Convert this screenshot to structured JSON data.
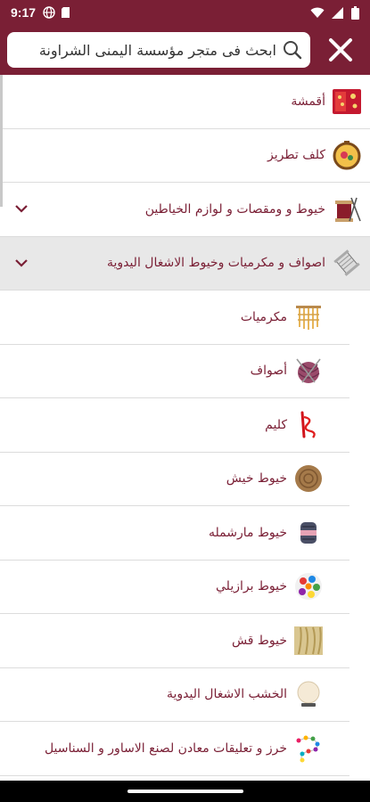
{
  "status": {
    "time": "9:17"
  },
  "search": {
    "placeholder": "ابحث فى متجر مؤسسة اليمنى الشراونة",
    "value": ""
  },
  "categories": [
    {
      "label": "أقمشة",
      "icon": "fabric-icon",
      "has_children": false
    },
    {
      "label": "كلف تطريز",
      "icon": "embroidery-hoop-icon",
      "has_children": false
    },
    {
      "label": "خيوط و ومقصات و لوازم الخياطين",
      "icon": "sewing-supplies-icon",
      "has_children": true,
      "expanded": false
    },
    {
      "label": "اصواف و مكرميات وخيوط الاشغال اليدوية",
      "icon": "thread-spool-icon",
      "has_children": true,
      "expanded": true
    }
  ],
  "subcategories": [
    {
      "label": "مكرميات",
      "icon": "macrame-icon"
    },
    {
      "label": "أصواف",
      "icon": "yarn-ball-icon"
    },
    {
      "label": "كليم",
      "icon": "kilim-needle-icon"
    },
    {
      "label": "خيوط خيش",
      "icon": "jute-twine-icon"
    },
    {
      "label": "خيوط مارشمله",
      "icon": "marshmallow-yarn-icon"
    },
    {
      "label": "خيوط برازيلي",
      "icon": "brazilian-thread-icon"
    },
    {
      "label": "خيوط قش",
      "icon": "straw-thread-icon"
    },
    {
      "label": "الخشب الاشغال اليدوية",
      "icon": "wood-craft-icon"
    },
    {
      "label": "خرز و تعليقات معادن لصنع الاساور و السناسيل",
      "icon": "beads-icon"
    }
  ],
  "colors": {
    "brand": "#7a1f35",
    "open_row_bg": "#e8e8e8"
  }
}
